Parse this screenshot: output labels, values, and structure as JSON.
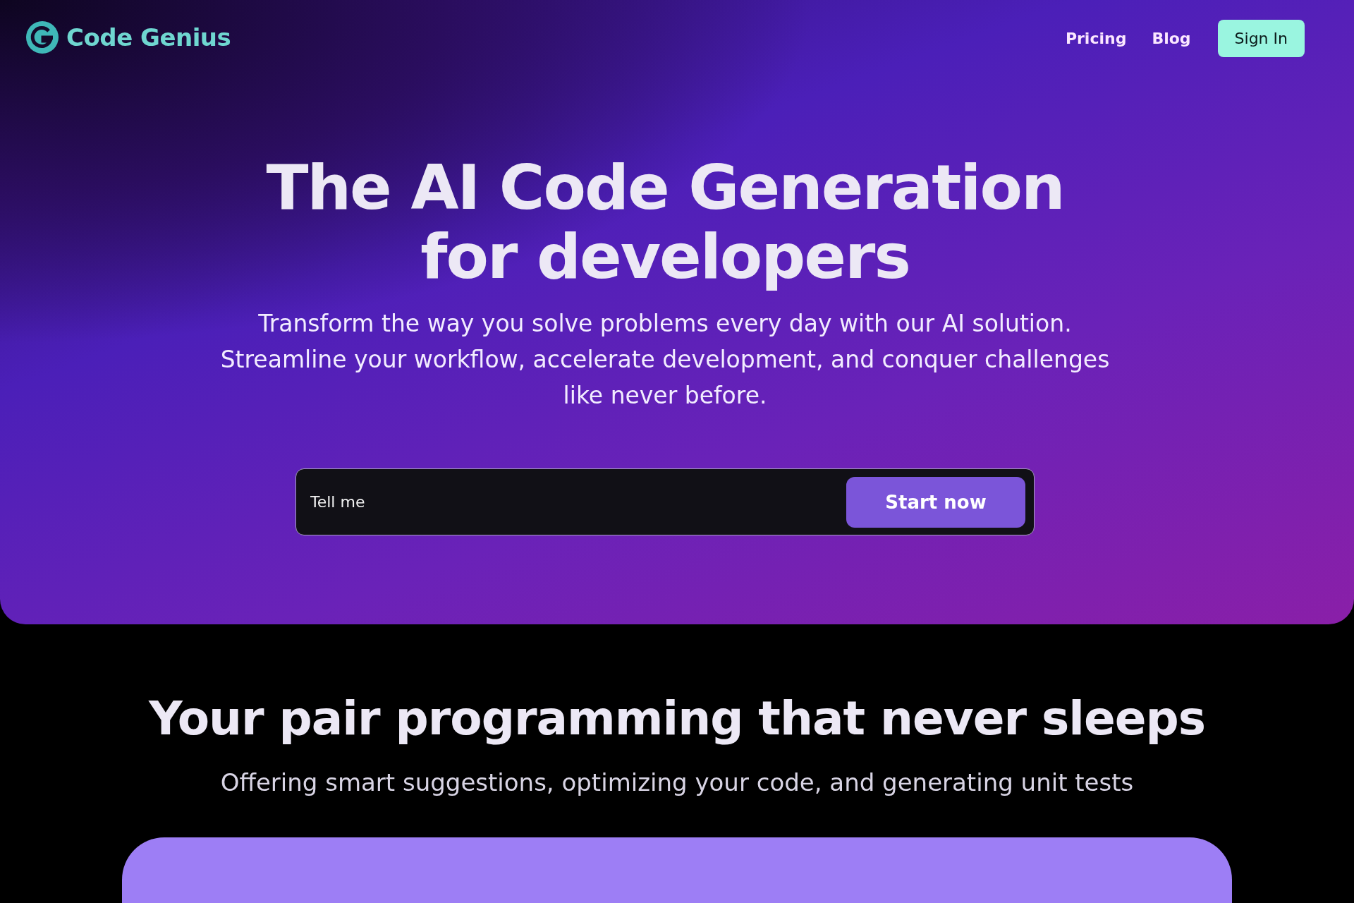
{
  "header": {
    "logo": "Code Genius",
    "nav": [
      {
        "label": "Pricing"
      },
      {
        "label": "Blog"
      }
    ],
    "sign_in": "Sign In"
  },
  "hero": {
    "title_lines": [
      "The AI Code Generation",
      "for developers"
    ],
    "subtitle": "Transform the way you solve problems every day with our AI solution. Streamline your workflow, accelerate development, and conquer challenges like never before.",
    "prompt": {
      "placeholder": "Tell me",
      "button": "Start now"
    }
  },
  "features": {
    "heading": "Your pair programming that never sleeps",
    "subheading": "Offering smart suggestions, optimizing your code, and generating unit tests"
  }
}
